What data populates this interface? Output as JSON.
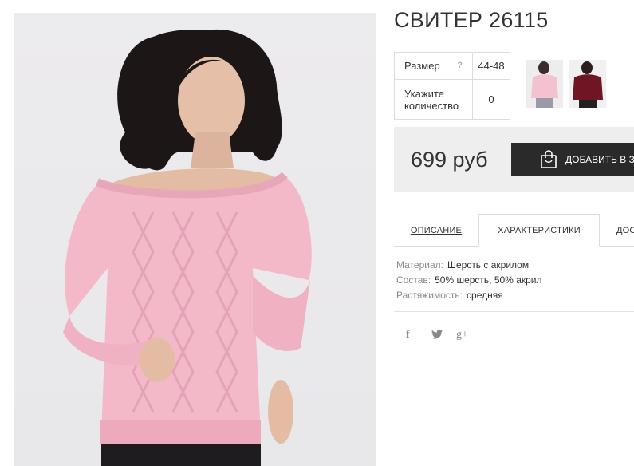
{
  "product": {
    "title": "СВИТЕР 26115",
    "price": "699 руб",
    "accent_color": "#2a2a2a",
    "photo_description_icon": "product-photo"
  },
  "options": {
    "size_label": "Размер",
    "size_help": "?",
    "size_value": "44-48",
    "qty_label": "Укажите количество",
    "qty_value": "0"
  },
  "cart": {
    "button_label": "ДОБАВИТЬ В ЗАКАЗ",
    "icon": "shopping-bag-icon"
  },
  "tabs": [
    {
      "label": "ОПИСАНИЕ"
    },
    {
      "label": "ХАРАКТЕРИСТИКИ"
    },
    {
      "label": "ДОСТАВКА"
    }
  ],
  "characteristics": [
    {
      "key": "Материал:",
      "value": "Шерсть с акрилом"
    },
    {
      "key": "Состав:",
      "value": "50% шерсть, 50% акрил"
    },
    {
      "key": "Растяжимость:",
      "value": "средняя"
    }
  ],
  "social": {
    "facebook": "f",
    "twitter": "🐦",
    "google_plus": "g+"
  }
}
